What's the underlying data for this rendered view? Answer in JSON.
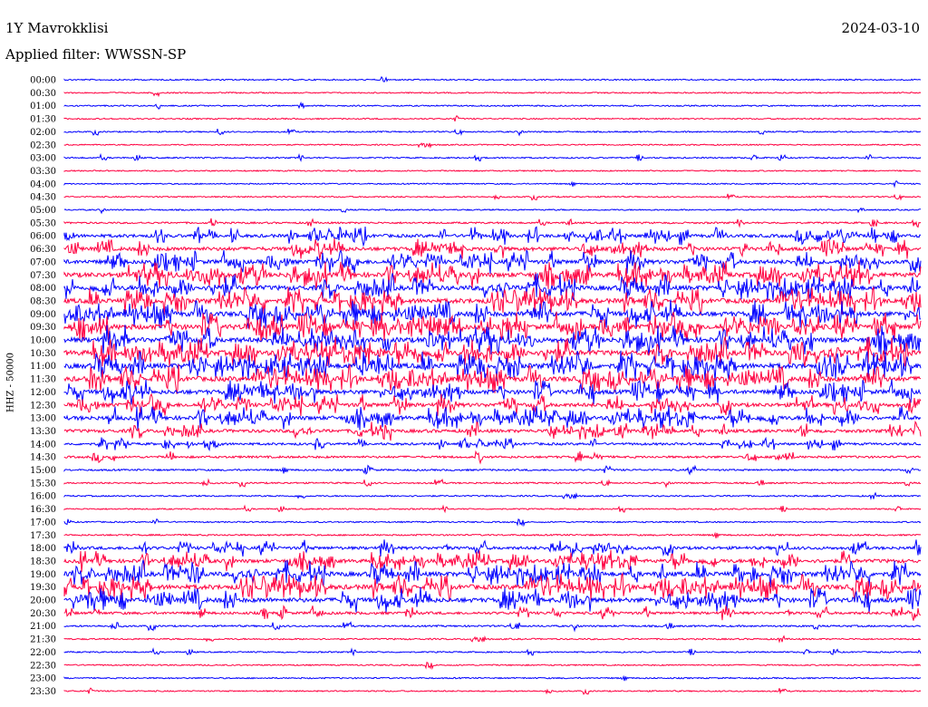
{
  "header": {
    "station": "1Y Mavrokklisi",
    "date": "2024-03-10",
    "filter": "Applied filter: WWSSN-SP"
  },
  "colors": {
    "trace_a": "#0000ff",
    "trace_b": "#ff0040",
    "text": "#000000"
  },
  "chart_data": {
    "type": "line",
    "title": "",
    "ylabel": "HHZ - 50000",
    "xlabel": "",
    "grid": false,
    "row_labels": [
      "00:00",
      "00:30",
      "01:00",
      "01:30",
      "02:00",
      "02:30",
      "03:00",
      "03:30",
      "04:00",
      "04:30",
      "05:00",
      "05:30",
      "06:00",
      "06:30",
      "07:00",
      "07:30",
      "08:00",
      "08:30",
      "09:00",
      "09:30",
      "10:00",
      "10:30",
      "11:00",
      "11:30",
      "12:00",
      "12:30",
      "13:00",
      "13:30",
      "14:00",
      "14:30",
      "15:00",
      "15:30",
      "16:00",
      "16:30",
      "17:00",
      "17:30",
      "18:00",
      "18:30",
      "19:00",
      "19:30",
      "20:00",
      "20:30",
      "21:00",
      "21:30",
      "22:00",
      "22:30",
      "23:00",
      "23:30"
    ],
    "row_colors": [
      "blue",
      "red"
    ],
    "activity": [
      0.04,
      0.03,
      0.06,
      0.04,
      0.06,
      0.03,
      0.06,
      0.03,
      0.03,
      0.05,
      0.05,
      0.15,
      0.5,
      0.6,
      0.7,
      0.85,
      0.85,
      0.85,
      0.9,
      0.95,
      0.95,
      0.95,
      0.95,
      0.9,
      0.75,
      0.65,
      0.7,
      0.5,
      0.3,
      0.25,
      0.15,
      0.1,
      0.08,
      0.05,
      0.05,
      0.1,
      0.45,
      0.6,
      0.8,
      0.85,
      0.8,
      0.35,
      0.15,
      0.08,
      0.06,
      0.05,
      0.05,
      0.05
    ]
  }
}
